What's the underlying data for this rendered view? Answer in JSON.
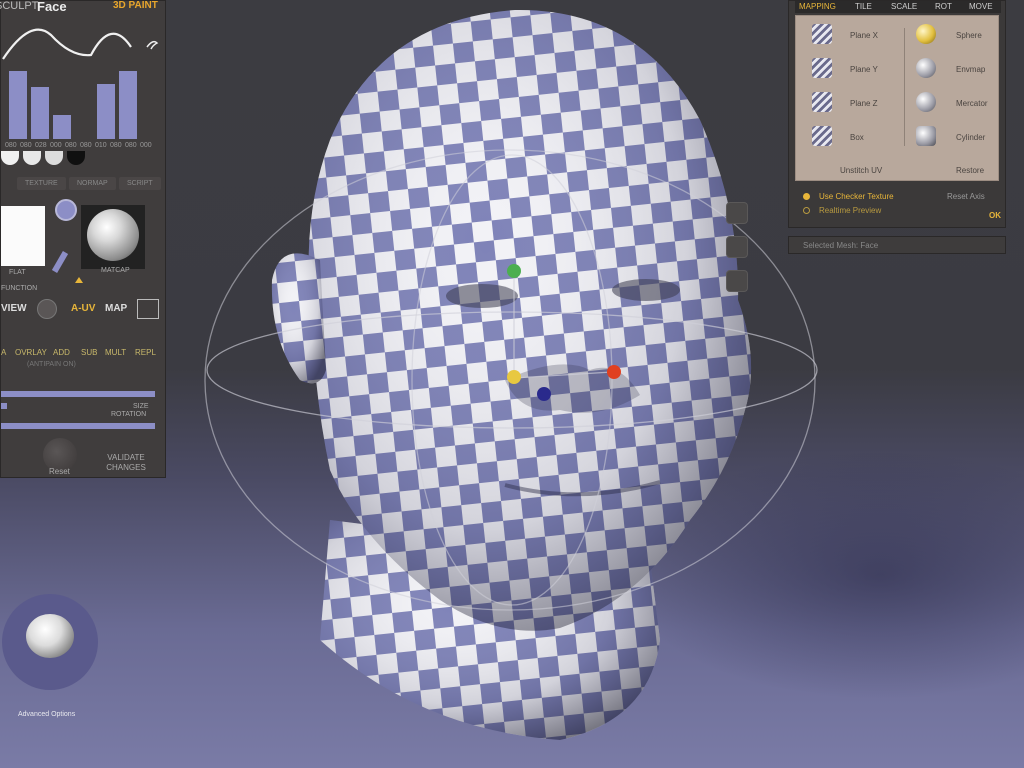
{
  "app": {
    "object_name": "Face",
    "mode_label": "3D PAINT",
    "left_title_fragment": "SCULPT"
  },
  "left_panel": {
    "curve_values": [
      "080",
      "080",
      "028",
      "000",
      "080",
      "080",
      "010",
      "080",
      "080",
      "000"
    ],
    "histogram": [
      68,
      52,
      24,
      0,
      55,
      68,
      0
    ],
    "channel_tabs": [
      "TEXTURE",
      "NORMAP",
      "SCRIPT"
    ],
    "flat_swatch_label": "FLAT",
    "matcap_label": "MATCAP",
    "section_label": "FUNCTION",
    "view_buttons": [
      "VIEW",
      "A-UV",
      "MAP"
    ],
    "blend_modes": [
      "A",
      "OVRLAY",
      "ADD",
      "SUB",
      "MULT",
      "REPL"
    ],
    "blend_hint": "(ANTIPAIN ON)",
    "slider_labels": [
      "SIZE",
      "ROTATION"
    ],
    "reset_label": "Reset",
    "validate_label": "VALIDATE CHANGES"
  },
  "right_panel": {
    "tabs": [
      "MAPPING",
      "TILE",
      "SCALE",
      "ROT",
      "MOVE"
    ],
    "active_tab": "MAPPING",
    "left_options": [
      "Plane X",
      "Plane Y",
      "Plane Z",
      "Box"
    ],
    "right_options": [
      "Sphere",
      "Envmap",
      "Mercator",
      "Cylinder"
    ],
    "selected_right": "Sphere",
    "unstretch_label": "Unstitch UV",
    "restore_label": "Restore",
    "checker_option": "Use Checker Texture",
    "realtime_option": "Realtime Preview",
    "reset_axis_label": "Reset Axis",
    "ok_label": "OK",
    "selected_mesh_label": "Selected Mesh: Face",
    "accent_color": "#e8b63a"
  },
  "viewport": {
    "advanced_options_label": "Advanced Options",
    "gizmo_colors": [
      "#4caf50",
      "#e8c840",
      "#e04020",
      "#2a2a8c"
    ],
    "checker_colors": [
      "#f2f2f6",
      "#7f83b8"
    ],
    "floor_color": "#6a6b94"
  }
}
